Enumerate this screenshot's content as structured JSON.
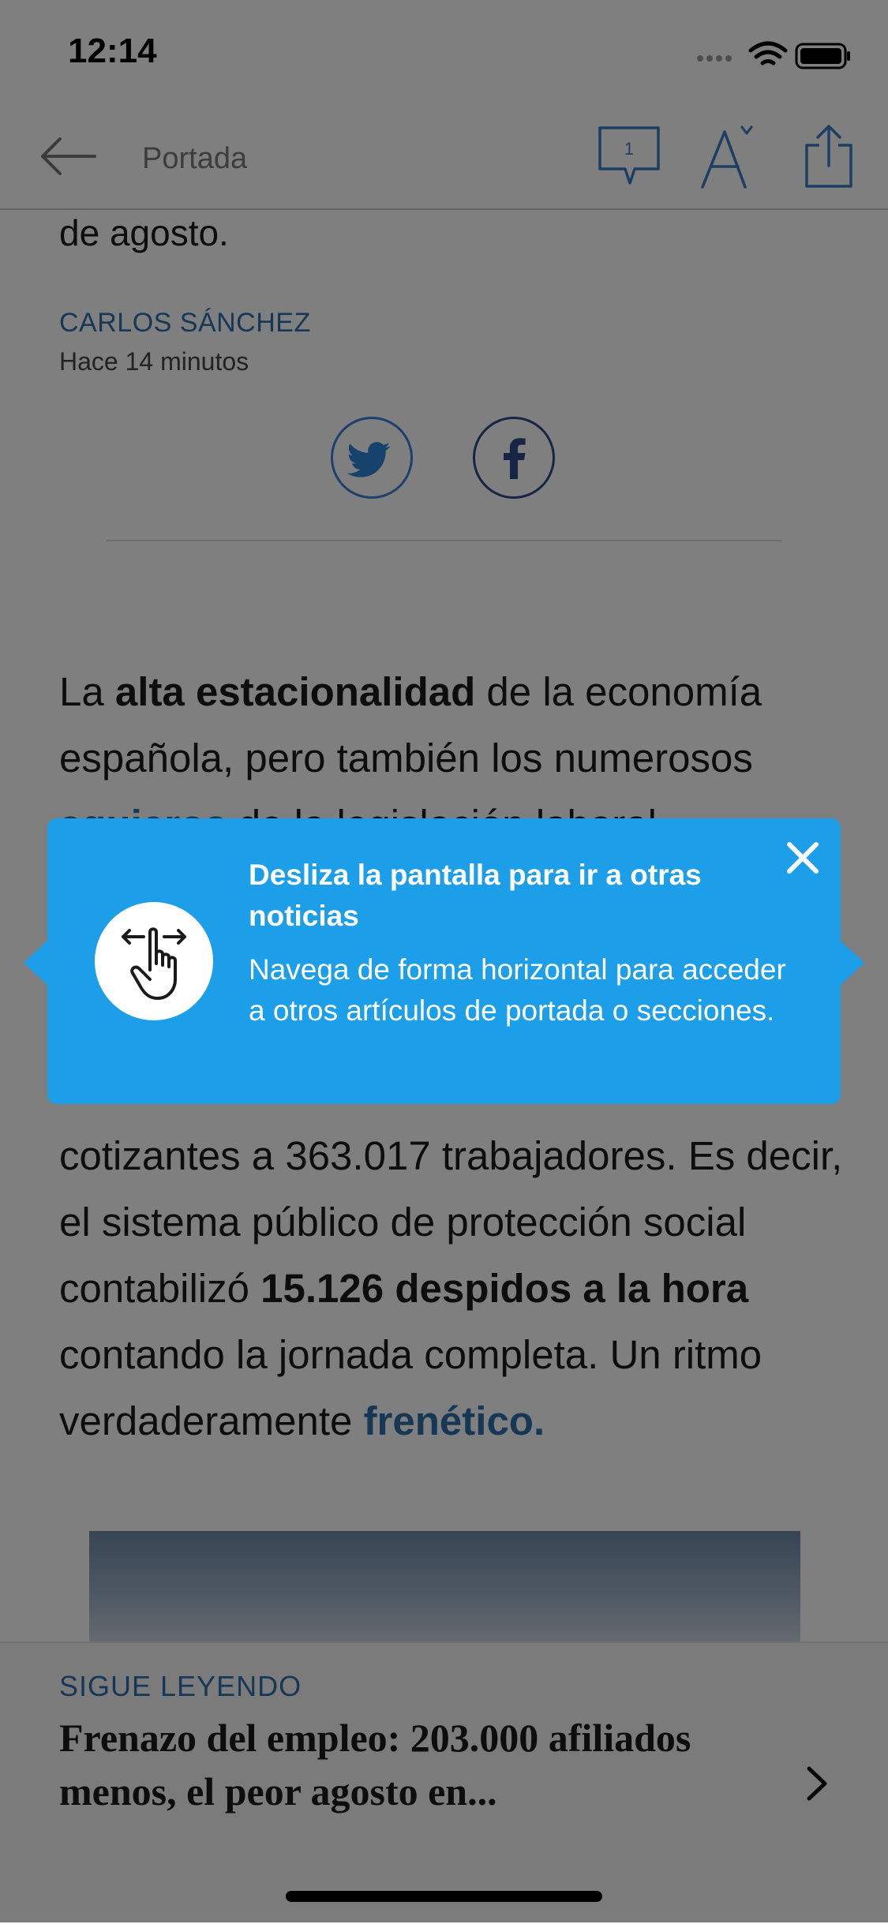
{
  "status_bar": {
    "time": "12:14"
  },
  "nav": {
    "title": "Portada",
    "comment_count": "1"
  },
  "article": {
    "lead_tail": "de agosto.",
    "author": "CARLOS SÁNCHEZ",
    "time_ago": "Hace 14 minutos",
    "para1": {
      "p1": "La ",
      "b1": "alta estacionalidad",
      "p2": " de la economía española, pero también los numerosos ",
      "link1": "agujeros",
      "p3": " de la legislación laboral"
    },
    "para2": {
      "p1": "cotizantes a 363.017 trabajadores. Es decir, el sistema público de protección social contabilizó ",
      "b1": "15.126 despidos a la hora",
      "p2": " contando la jornada completa. Un ritmo verdaderamente ",
      "link1": "frenético."
    }
  },
  "continue_reading": {
    "label": "SIGUE LEYENDO",
    "title": "Frenazo del empleo: 203.000 afiliados menos, el peor agosto en..."
  },
  "tooltip": {
    "title": "Desliza la pantalla para ir a otras noticias",
    "description": "Navega de forma horizontal para acceder a otros artículos de portada o secciones."
  },
  "colors": {
    "accent": "#2f6fae",
    "tooltip_bg": "#1c9fe8",
    "overlay": "rgba(0,0,0,0.5)"
  },
  "icons": [
    "back-arrow-icon",
    "comment-icon",
    "font-size-icon",
    "share-icon",
    "twitter-icon",
    "facebook-icon",
    "swipe-hand-icon",
    "close-icon",
    "chevron-right-icon",
    "wifi-icon",
    "battery-icon",
    "signal-icon"
  ]
}
